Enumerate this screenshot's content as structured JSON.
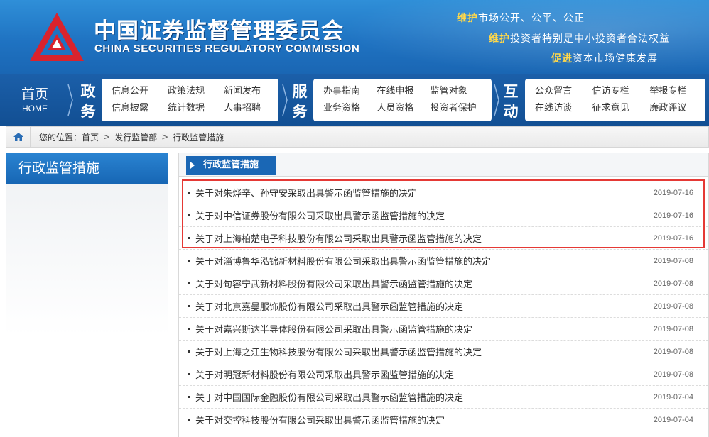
{
  "header": {
    "title_cn": "中国证券监督管理委员会",
    "title_en": "CHINA SECURITIES REGULATORY COMMISSION",
    "slogans": [
      {
        "lead": "维护",
        "rest": "市场公开、公平、公正"
      },
      {
        "lead": "维护",
        "rest": "投资者特别是中小投资者合法权益"
      },
      {
        "lead": "促进",
        "rest": "资本市场健康发展"
      }
    ],
    "colors": {
      "brand_blue": "#1f73c2",
      "logo_red": "#d9232d",
      "accent_yellow": "#ffd84a"
    }
  },
  "nav": {
    "home": {
      "cn": "首页",
      "en": "HOME"
    },
    "groups": [
      {
        "category": "政务",
        "links": [
          "信息公开",
          "政策法规",
          "新闻发布",
          "信息披露",
          "统计数据",
          "人事招聘"
        ]
      },
      {
        "category": "服务",
        "links": [
          "办事指南",
          "在线申报",
          "监管对象",
          "业务资格",
          "人员资格",
          "投资者保护"
        ]
      },
      {
        "category": "互动",
        "links": [
          "公众留言",
          "信访专栏",
          "举报专栏",
          "在线访谈",
          "征求意见",
          "廉政评议"
        ]
      }
    ]
  },
  "breadcrumb": {
    "prefix": "您的位置：",
    "items": [
      "首页",
      "发行监管部",
      "行政监管措施"
    ],
    "separator": ">"
  },
  "sidebar": {
    "title": "行政监管措施"
  },
  "main": {
    "tab_label": "行政监管措施",
    "items": [
      {
        "title": "关于对朱烨辛、孙守安采取出具警示函监管措施的决定",
        "date": "2019-07-16"
      },
      {
        "title": "关于对中信证券股份有限公司采取出具警示函监管措施的决定",
        "date": "2019-07-16"
      },
      {
        "title": "关于对上海柏楚电子科技股份有限公司采取出具警示函监管措施的决定",
        "date": "2019-07-16"
      },
      {
        "title": "关于对淄博鲁华泓锦新材料股份有限公司采取出具警示函监管措施的决定",
        "date": "2019-07-08"
      },
      {
        "title": "关于对句容宁武新材料股份有限公司采取出具警示函监管措施的决定",
        "date": "2019-07-08"
      },
      {
        "title": "关于对北京嘉曼服饰股份有限公司采取出具警示函监管措施的决定",
        "date": "2019-07-08"
      },
      {
        "title": "关于对嘉兴斯达半导体股份有限公司采取出具警示函监管措施的决定",
        "date": "2019-07-08"
      },
      {
        "title": "关于对上海之江生物科技股份有限公司采取出具警示函监管措施的决定",
        "date": "2019-07-08"
      },
      {
        "title": "关于对明冠新材料股份有限公司采取出具警示函监管措施的决定",
        "date": "2019-07-08"
      },
      {
        "title": "关于对中国国际金融股份有限公司采取出具警示函监管措施的决定",
        "date": "2019-07-04"
      },
      {
        "title": "关于对交控科技股份有限公司采取出具警示函监管措施的决定",
        "date": "2019-07-04"
      }
    ]
  }
}
